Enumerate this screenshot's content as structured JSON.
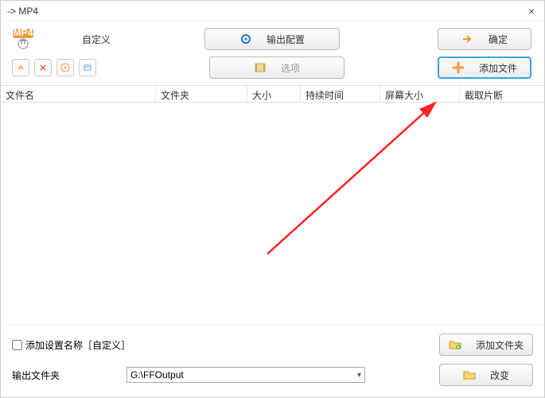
{
  "window": {
    "title": " -> MP4"
  },
  "top": {
    "profile_label": "自定义",
    "output_config_btn": "输出配置",
    "ok_btn": "确定"
  },
  "second": {
    "options_btn": "选项",
    "add_file_btn": "添加文件"
  },
  "table": {
    "headers": [
      "文件名",
      "文件夹",
      "大小",
      "持续时间",
      "屏幕大小",
      "截取片断"
    ]
  },
  "bottom": {
    "checkbox_label": "添加设置名称［自定义］",
    "add_folder_btn": "添加文件夹",
    "output_folder_label": "输出文件夹",
    "output_path": "G:\\FFOutput",
    "change_btn": "改变"
  }
}
